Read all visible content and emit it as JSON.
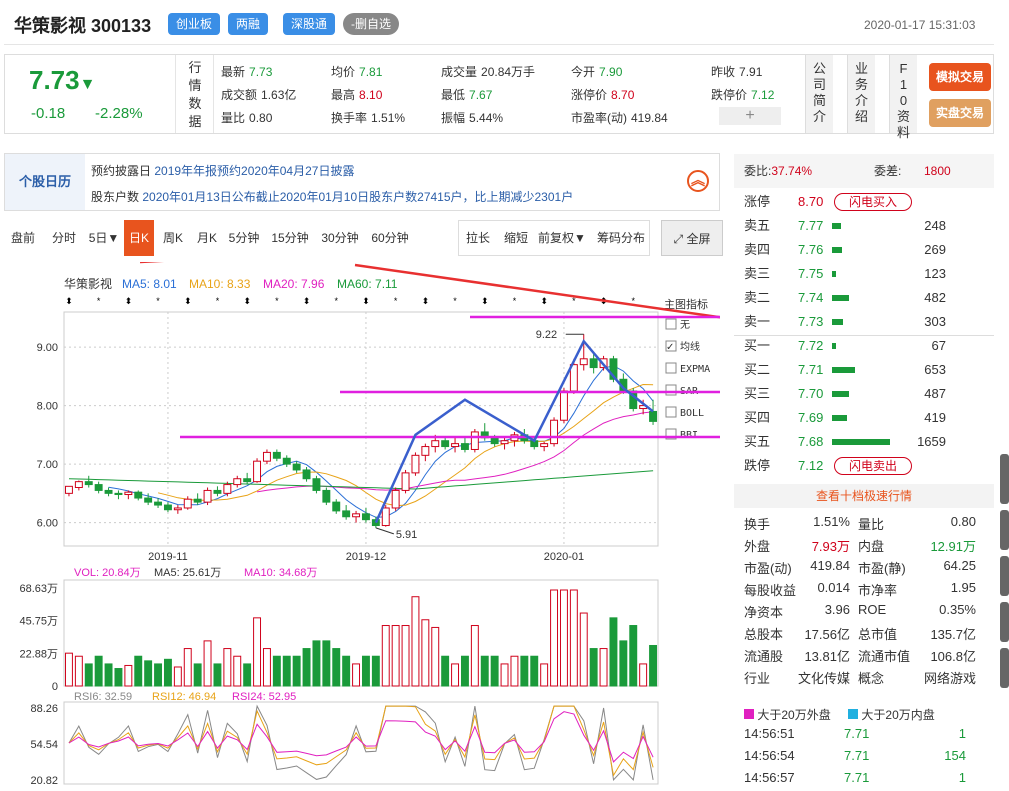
{
  "header": {
    "name": "华策影视",
    "code": "300133",
    "badges": [
      "创业板",
      "两融",
      "深股通",
      "-删自选"
    ],
    "datetime": "2020-01-17 15:31:03"
  },
  "quote": {
    "price": "7.73",
    "arrow": "▼",
    "change": "-0.18",
    "pct": "-2.28%",
    "vlabel": [
      "行",
      "情",
      "数",
      "据"
    ],
    "cols": [
      [
        {
          "k": "最新",
          "v": "7.73",
          "c": "v"
        },
        {
          "k": "成交额",
          "v": "1.63亿",
          "c": "n"
        },
        {
          "k": "量比",
          "v": "0.80",
          "c": "n"
        }
      ],
      [
        {
          "k": "均价",
          "v": "7.81",
          "c": "v"
        },
        {
          "k": "最高",
          "v": "8.10",
          "c": "r"
        },
        {
          "k": "换手率",
          "v": "1.51%",
          "c": "n"
        }
      ],
      [
        {
          "k": "成交量",
          "v": "20.84万手",
          "c": "n"
        },
        {
          "k": "最低",
          "v": "7.67",
          "c": "v"
        },
        {
          "k": "振幅",
          "v": "5.44%",
          "c": "n"
        }
      ],
      [
        {
          "k": "今开",
          "v": "7.90",
          "c": "v"
        },
        {
          "k": "涨停价",
          "v": "8.70",
          "c": "r"
        },
        {
          "k": "市盈率(动)",
          "v": "419.84",
          "c": "n"
        }
      ],
      [
        {
          "k": "昨收",
          "v": "7.91",
          "c": "n"
        },
        {
          "k": "跌停价",
          "v": "7.12",
          "c": "v"
        },
        {
          "k": "",
          "v": "+",
          "c": "n"
        }
      ]
    ],
    "tabs": [
      [
        "公",
        "司",
        "简",
        "介"
      ],
      [
        "业",
        "务",
        "介",
        "绍"
      ],
      [
        "F",
        "1",
        "0",
        "资",
        "料"
      ]
    ],
    "buttons": [
      "模拟交易",
      "实盘交易"
    ]
  },
  "calendar": {
    "tab": "个股日历",
    "rows": [
      {
        "k": "预约披露日",
        "v": "2019年年报预约2020年04月27日披露"
      },
      {
        "k": "股东户数",
        "v": "2020年01月13日公布截止2020年01月10日股东户数27415户，比上期减少2301户"
      }
    ]
  },
  "toolbar": {
    "periods": [
      "盘前",
      "分时",
      "5日▼",
      "日K",
      "周K",
      "月K",
      "5分钟",
      "15分钟",
      "30分钟",
      "60分钟"
    ],
    "active": "日K",
    "tools": [
      "拉长",
      "缩短",
      "前复权▼",
      "筹码分布"
    ],
    "full": "全屏"
  },
  "chart_data": {
    "type": "candlestick",
    "title": "华策影视",
    "ma": [
      {
        "name": "MA5",
        "value": "8.01",
        "color": "#2a6fd6"
      },
      {
        "name": "MA10",
        "value": "8.33",
        "color": "#e8a317"
      },
      {
        "name": "MA20",
        "value": "7.96",
        "color": "#e020c0"
      },
      {
        "name": "MA60",
        "value": "7.11",
        "color": "#1a9a3a"
      }
    ],
    "yticks": [
      "9.00",
      "8.00",
      "7.00",
      "6.00"
    ],
    "xticks": [
      "2019-11",
      "2019-12",
      "2020-01"
    ],
    "ylim": [
      5.6,
      9.6
    ],
    "high_label": "9.22",
    "low_label": "5.91",
    "indicators": {
      "title": "主图指标",
      "items": [
        "无",
        "均线",
        "EXPMA",
        "SAR",
        "BOLL",
        "BBI"
      ],
      "checked": "均线"
    },
    "candles": [
      [
        6.5,
        6.6,
        6.45,
        6.62
      ],
      [
        6.6,
        6.72,
        6.55,
        6.7
      ],
      [
        6.7,
        6.8,
        6.6,
        6.65
      ],
      [
        6.65,
        6.7,
        6.5,
        6.55
      ],
      [
        6.55,
        6.6,
        6.45,
        6.5
      ],
      [
        6.5,
        6.55,
        6.4,
        6.48
      ],
      [
        6.48,
        6.55,
        6.4,
        6.52
      ],
      [
        6.52,
        6.55,
        6.38,
        6.42
      ],
      [
        6.42,
        6.5,
        6.3,
        6.35
      ],
      [
        6.35,
        6.42,
        6.25,
        6.3
      ],
      [
        6.3,
        6.35,
        6.18,
        6.22
      ],
      [
        6.22,
        6.3,
        6.15,
        6.25
      ],
      [
        6.25,
        6.45,
        6.22,
        6.4
      ],
      [
        6.4,
        6.5,
        6.3,
        6.35
      ],
      [
        6.35,
        6.6,
        6.3,
        6.55
      ],
      [
        6.55,
        6.62,
        6.45,
        6.5
      ],
      [
        6.5,
        6.7,
        6.45,
        6.65
      ],
      [
        6.65,
        6.8,
        6.6,
        6.75
      ],
      [
        6.75,
        6.85,
        6.65,
        6.7
      ],
      [
        6.7,
        7.1,
        6.68,
        7.05
      ],
      [
        7.05,
        7.25,
        7.0,
        7.2
      ],
      [
        7.2,
        7.25,
        7.05,
        7.1
      ],
      [
        7.1,
        7.15,
        6.95,
        7.0
      ],
      [
        7.0,
        7.05,
        6.85,
        6.9
      ],
      [
        6.9,
        6.95,
        6.7,
        6.75
      ],
      [
        6.75,
        6.8,
        6.5,
        6.55
      ],
      [
        6.55,
        6.6,
        6.3,
        6.35
      ],
      [
        6.35,
        6.4,
        6.15,
        6.2
      ],
      [
        6.2,
        6.3,
        6.05,
        6.1
      ],
      [
        6.1,
        6.2,
        6.0,
        6.15
      ],
      [
        6.15,
        6.25,
        6.0,
        6.05
      ],
      [
        6.05,
        6.1,
        5.91,
        5.95
      ],
      [
        5.95,
        6.3,
        5.93,
        6.25
      ],
      [
        6.25,
        6.6,
        6.2,
        6.55
      ],
      [
        6.55,
        6.9,
        6.5,
        6.85
      ],
      [
        6.85,
        7.2,
        6.8,
        7.15
      ],
      [
        7.15,
        7.35,
        7.05,
        7.3
      ],
      [
        7.3,
        7.5,
        7.2,
        7.4
      ],
      [
        7.4,
        7.45,
        7.25,
        7.3
      ],
      [
        7.3,
        7.45,
        7.2,
        7.35
      ],
      [
        7.35,
        7.45,
        7.2,
        7.25
      ],
      [
        7.25,
        7.6,
        7.2,
        7.55
      ],
      [
        7.55,
        7.7,
        7.4,
        7.45
      ],
      [
        7.45,
        7.5,
        7.3,
        7.35
      ],
      [
        7.35,
        7.45,
        7.25,
        7.4
      ],
      [
        7.4,
        7.55,
        7.3,
        7.5
      ],
      [
        7.5,
        7.6,
        7.35,
        7.4
      ],
      [
        7.4,
        7.45,
        7.25,
        7.3
      ],
      [
        7.3,
        7.38,
        7.22,
        7.35
      ],
      [
        7.35,
        7.8,
        7.3,
        7.75
      ],
      [
        7.75,
        8.3,
        7.7,
        8.25
      ],
      [
        8.25,
        8.8,
        8.2,
        8.7
      ],
      [
        8.7,
        9.22,
        8.6,
        8.8
      ],
      [
        8.8,
        8.9,
        8.55,
        8.65
      ],
      [
        8.65,
        8.85,
        8.6,
        8.8
      ],
      [
        8.8,
        8.85,
        8.4,
        8.45
      ],
      [
        8.45,
        8.55,
        8.2,
        8.25
      ],
      [
        8.25,
        8.3,
        7.9,
        7.95
      ],
      [
        7.95,
        8.1,
        7.85,
        8.0
      ],
      [
        7.9,
        8.1,
        7.67,
        7.73
      ]
    ],
    "volume": {
      "label": "VOL: 20.84万",
      "ma5": "MA5: 25.61万",
      "ma10": "MA10: 34.68万",
      "yticks": [
        "68.63万",
        "45.75万",
        "22.88万",
        "0"
      ]
    },
    "rsi": {
      "rsi6": "RSI6: 32.59",
      "rsi12": "RSI12: 46.94",
      "rsi24": "RSI24: 52.95",
      "yticks": [
        "88.26",
        "54.54",
        "20.82"
      ]
    }
  },
  "orderbook": {
    "weibi_label": "委比:",
    "weibi": "37.74%",
    "weicha_label": "委差:",
    "weicha": "1800",
    "limit_up": {
      "k": "涨停",
      "v": "8.70",
      "btn": "闪电买入"
    },
    "asks": [
      {
        "k": "卖五",
        "p": "7.77",
        "q": "248"
      },
      {
        "k": "卖四",
        "p": "7.76",
        "q": "269"
      },
      {
        "k": "卖三",
        "p": "7.75",
        "q": "123"
      },
      {
        "k": "卖二",
        "p": "7.74",
        "q": "482"
      },
      {
        "k": "卖一",
        "p": "7.73",
        "q": "303"
      }
    ],
    "bids": [
      {
        "k": "买一",
        "p": "7.72",
        "q": "67"
      },
      {
        "k": "买二",
        "p": "7.71",
        "q": "653"
      },
      {
        "k": "买三",
        "p": "7.70",
        "q": "487"
      },
      {
        "k": "买四",
        "p": "7.69",
        "q": "419"
      },
      {
        "k": "买五",
        "p": "7.68",
        "q": "1659"
      }
    ],
    "limit_down": {
      "k": "跌停",
      "v": "7.12",
      "btn": "闪电卖出"
    },
    "more": "查看十档极速行情"
  },
  "stats": [
    [
      {
        "k": "换手",
        "v": "1.51%"
      },
      {
        "k": "量比",
        "v": "0.80"
      }
    ],
    [
      {
        "k": "外盘",
        "v": "7.93万",
        "c": "red"
      },
      {
        "k": "内盘",
        "v": "12.91万",
        "c": "grn"
      }
    ],
    [
      {
        "k": "市盈(动)",
        "v": "419.84"
      },
      {
        "k": "市盈(静)",
        "v": "64.25"
      }
    ],
    [
      {
        "k": "每股收益",
        "v": "0.014"
      },
      {
        "k": "市净率",
        "v": "1.95"
      }
    ],
    [
      {
        "k": "净资本",
        "v": "3.96"
      },
      {
        "k": "ROE",
        "v": "0.35%"
      }
    ],
    [
      {
        "k": "总股本",
        "v": "17.56亿"
      },
      {
        "k": "总市值",
        "v": "135.7亿"
      }
    ],
    [
      {
        "k": "流通股",
        "v": "13.81亿"
      },
      {
        "k": "流通市值",
        "v": "106.8亿"
      }
    ],
    [
      {
        "k": "行业",
        "v": "文化传媒"
      },
      {
        "k": "概念",
        "v": "网络游戏"
      }
    ]
  ],
  "ticks_legend": [
    "大于20万外盘",
    "大于20万内盘"
  ],
  "ticks": [
    {
      "t": "14:56:51",
      "p": "7.71",
      "q": "1"
    },
    {
      "t": "14:56:54",
      "p": "7.71",
      "q": "154"
    },
    {
      "t": "14:56:57",
      "p": "7.71",
      "q": "1"
    }
  ]
}
